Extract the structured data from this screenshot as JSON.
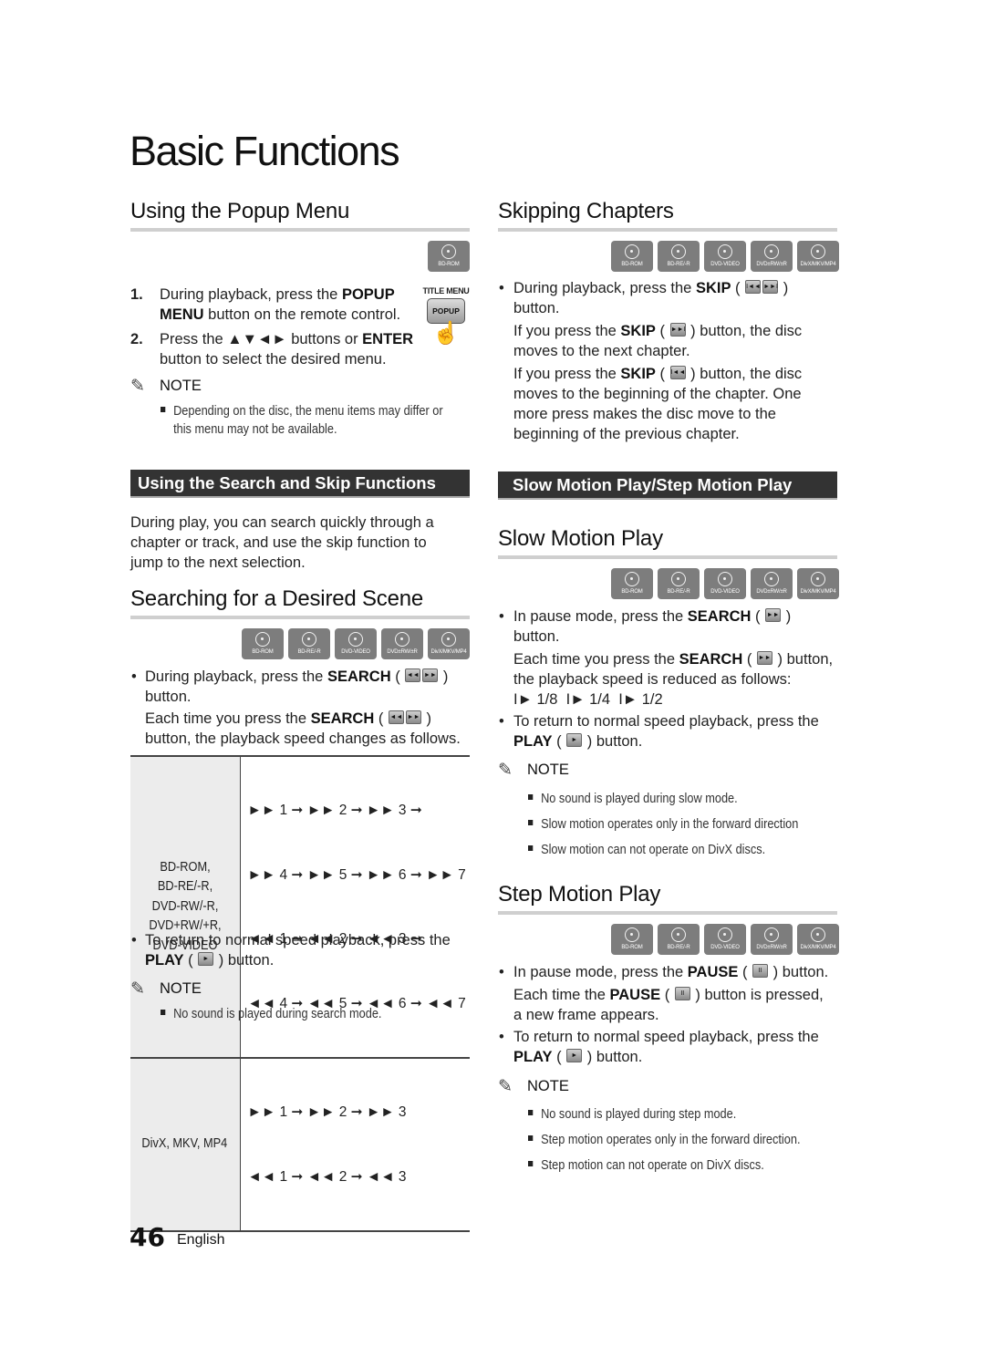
{
  "page_title": "Basic Functions",
  "footer": {
    "page_number": "46",
    "language": "English"
  },
  "disc_labels": {
    "bd_rom": "BD-ROM",
    "bd_re_r": "BD-RE/-R",
    "dvd_video": "DVD-VIDEO",
    "dvd_rw_r": "DVD±RW/±R",
    "divx": "DivX/MKV/MP4"
  },
  "note_label": "NOTE",
  "popup_menu": {
    "heading": "Using the Popup Menu",
    "remote_caption": "TITLE MENU",
    "remote_button": "POPUP",
    "steps": [
      {
        "num": "1.",
        "pre": "During playback, press the ",
        "bold1": "POPUP",
        "mid": "",
        "line2_bold": "MENU",
        "line2": " button on the remote control."
      },
      {
        "num": "2.",
        "pre": "Press the ▲▼◄► buttons or ",
        "bold1": "ENTER",
        "line2": "button to select the desired menu."
      }
    ],
    "notes": [
      "Depending on the disc, the menu items may differ or",
      "this menu may not be available."
    ]
  },
  "search_skip": {
    "bar_title": "Using the Search and Skip Functions",
    "intro": [
      "During play, you can search quickly through a",
      "chapter or track, and use the skip function to",
      "jump to the next selection."
    ]
  },
  "searching": {
    "heading": "Searching for a Desired Scene",
    "bullet1_pre": "During playback, press the ",
    "bullet1_bold": "SEARCH",
    "bullet1_line2": "button.",
    "each_pre": "Each time you press the ",
    "each_bold": "SEARCH",
    "each_line2": "button, the playback speed changes as follows.",
    "table": [
      {
        "formats": [
          "BD-ROM,",
          "BD-RE/-R,",
          "DVD-RW/-R,",
          "DVD+RW/+R,",
          "DVD-VIDEO"
        ],
        "sequence": [
          "►► 1 ➞ ►► 2 ➞ ►► 3 ➞",
          "►► 4 ➞ ►► 5 ➞ ►► 6 ➞ ►► 7",
          "◄◄ 1 ➞ ◄◄ 2 ➞ ◄◄ 3 ➞",
          "◄◄ 4 ➞ ◄◄ 5 ➞ ◄◄ 6 ➞ ◄◄ 7"
        ]
      },
      {
        "formats": [
          "DivX, MKV, MP4"
        ],
        "sequence": [
          "►► 1 ➞ ►► 2 ➞ ►► 3",
          "◄◄ 1 ➞ ◄◄ 2 ➞ ◄◄ 3"
        ]
      }
    ],
    "return_pre": "To return to normal speed playback, press the",
    "return_bold": "PLAY",
    "return_post": " button.",
    "notes": [
      "No sound is played during search mode."
    ]
  },
  "skipping": {
    "heading": "Skipping Chapters",
    "bullet_pre": "During playback, press the ",
    "bullet_bold": "SKIP",
    "bullet_line2": "button.",
    "next_pre": "If you press the ",
    "next_bold": "SKIP",
    "next_post": " button, the disc",
    "next_line2": "moves to the next chapter.",
    "prev_pre": "If you press the ",
    "prev_bold": "SKIP",
    "prev_post": " button, the disc",
    "prev_lines": [
      "moves to the beginning of the chapter. One",
      "more press makes the disc move to the",
      "beginning of the previous chapter."
    ]
  },
  "motion_bar": {
    "title": "Slow Motion Play/Step Motion Play"
  },
  "slow_motion": {
    "heading": "Slow Motion Play",
    "bullet_pre": "In pause mode, press the ",
    "bullet_bold": "SEARCH",
    "bullet_line2": "button.",
    "each_pre": "Each time you press the ",
    "each_bold": "SEARCH",
    "each_post": " button,",
    "each_line2": "the playback speed is reduced as follows:",
    "speeds": "I► 1/8  I► 1/4  I► 1/2",
    "return_pre": "To return to normal speed playback, press the",
    "return_bold": "PLAY",
    "return_post": " button.",
    "notes": [
      "No sound is played during slow mode.",
      "Slow motion operates only in the forward direction",
      "Slow motion can not operate on DivX discs."
    ]
  },
  "step_motion": {
    "heading": "Step Motion Play",
    "bullet_pre": "In pause mode, press the ",
    "bullet_bold": "PAUSE",
    "bullet_post": " button.",
    "each_pre": "Each time the ",
    "each_bold": "PAUSE",
    "each_post": " button is pressed,",
    "each_line2": "a new frame appears.",
    "return_pre": "To return to normal speed playback, press the",
    "return_bold": "PLAY",
    "return_post": " button.",
    "notes": [
      "No sound is played during step mode.",
      "Step motion operates only in the forward direction.",
      "Step motion can not operate on DivX discs."
    ]
  }
}
